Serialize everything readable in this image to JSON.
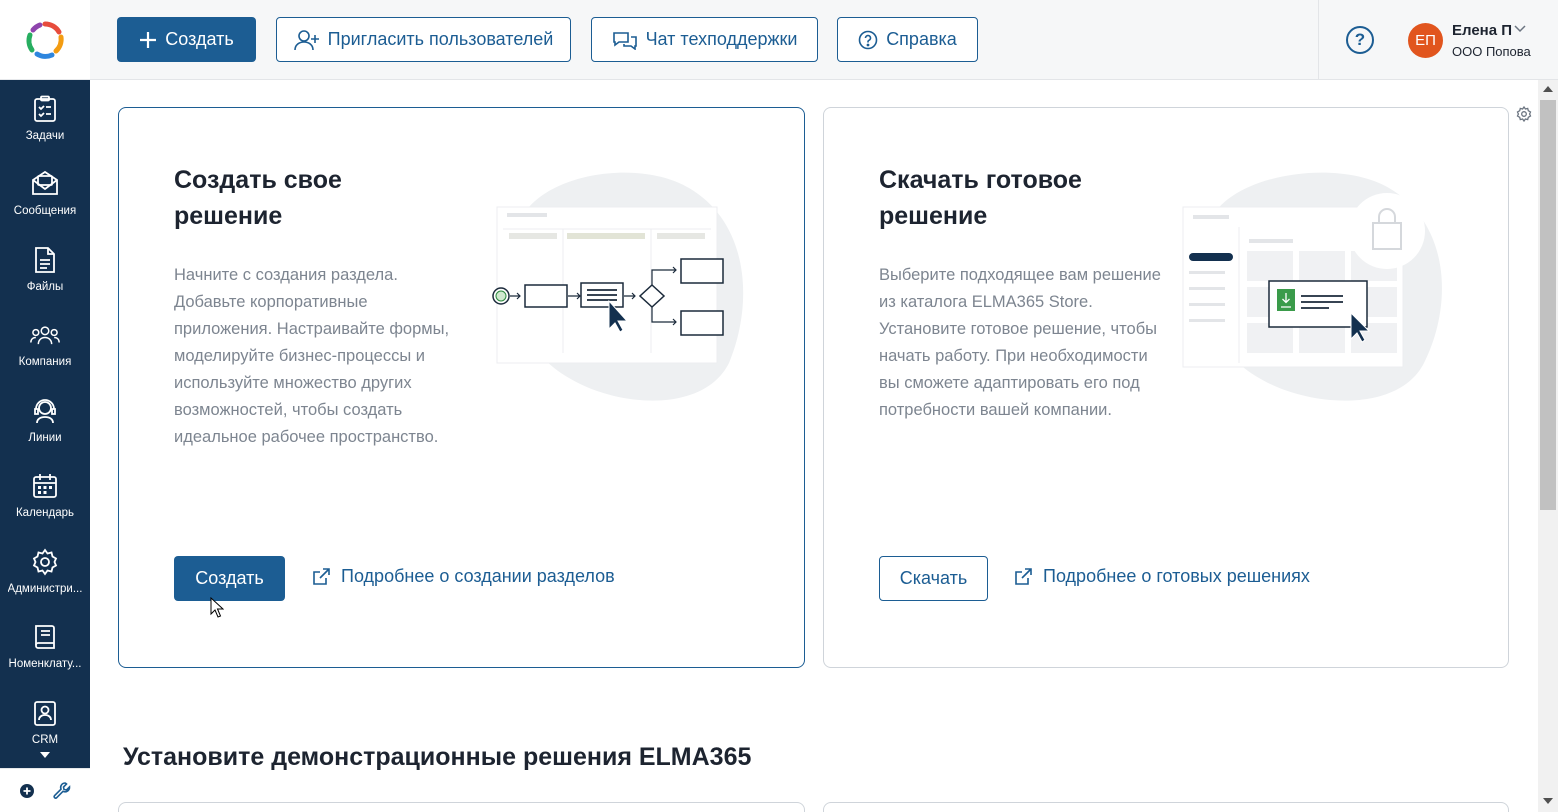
{
  "sidebar": {
    "items": [
      {
        "label": "Задачи",
        "icon": "tasks-icon"
      },
      {
        "label": "Сообщения",
        "icon": "messages-icon"
      },
      {
        "label": "Файлы",
        "icon": "files-icon"
      },
      {
        "label": "Компания",
        "icon": "company-icon"
      },
      {
        "label": "Линии",
        "icon": "lines-icon"
      },
      {
        "label": "Календарь",
        "icon": "calendar-icon"
      },
      {
        "label": "Администри...",
        "icon": "admin-gear-icon"
      },
      {
        "label": "Номенклату...",
        "icon": "nomenclature-icon"
      },
      {
        "label": "CRM",
        "icon": "crm-icon"
      }
    ]
  },
  "toolbar": {
    "create_label": "Создать",
    "invite_label": "Пригласить пользователей",
    "support_label": "Чат техподдержки",
    "help_label": "Справка"
  },
  "user": {
    "initials": "ЕП",
    "name": "Елена П",
    "org": "ООО Попова",
    "avatar_color": "#e1551e"
  },
  "cards": [
    {
      "title": "Создать свое решение",
      "description": "Начните с создания раздела. Добавьте корпоративные приложения. Настраивайте формы, моделируйте бизнес-процессы и используйте множество других возможностей, чтобы создать идеальное рабочее пространство.",
      "button": "Создать",
      "link": "Подробнее о создании разделов"
    },
    {
      "title": "Скачать готовое решение",
      "description": "Выберите подходящее вам решение из каталога ELMA365 Store. Установите готовое решение, чтобы начать работу. При необходимости вы сможете адаптировать его под потребности вашей компании.",
      "button": "Скачать",
      "link": "Подробнее о готовых решениях"
    }
  ],
  "demo_section": {
    "title": "Установите демонстрационные решения ELMA365"
  },
  "colors": {
    "accent": "#1c5d93",
    "nav_bg": "#13304f"
  }
}
